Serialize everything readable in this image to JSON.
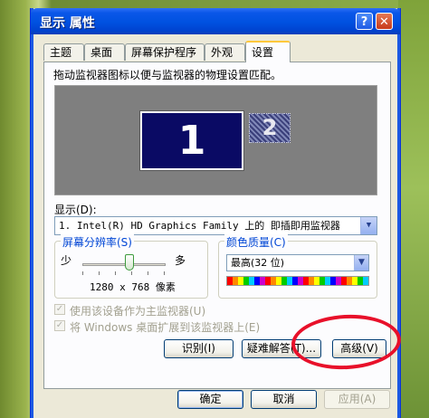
{
  "window": {
    "title": "显示 属性",
    "help_label": "?",
    "close_label": "✕"
  },
  "tabs": [
    "主题",
    "桌面",
    "屏幕保护程序",
    "外观",
    "设置"
  ],
  "active_tab": "设置",
  "settings": {
    "instruction": "拖动监视器图标以便与监视器的物理设置匹配。",
    "monitors": [
      {
        "label": "1",
        "selected": true
      },
      {
        "label": "2",
        "selected": false
      }
    ],
    "display_label": "显示(D):",
    "display_value": "1. Intel(R) HD Graphics Family 上的 即插即用监视器",
    "resolution": {
      "title": "屏幕分辨率(S)",
      "less_label": "少",
      "more_label": "多",
      "value": "1280 x 768 像素",
      "slider_level": 0.57
    },
    "color": {
      "title": "颜色质量(C)",
      "value": "最高(32 位)"
    },
    "checkboxes": [
      {
        "label": "使用该设备作为主监视器(U)",
        "checked": true,
        "enabled": false
      },
      {
        "label": "将 Windows 桌面扩展到该监视器上(E)",
        "checked": true,
        "enabled": false
      }
    ],
    "buttons": {
      "identify": "识别(I)",
      "troubleshoot": "疑难解答(T)...",
      "advanced": "高级(V)"
    }
  },
  "footer": {
    "ok": "确定",
    "cancel": "取消",
    "apply": "应用(A)"
  },
  "colors": {
    "titlebar": "#0051e0",
    "dialog_bg": "#ece9d8",
    "monitor_primary": "#0a0a64",
    "annotation": "#e8102a"
  }
}
